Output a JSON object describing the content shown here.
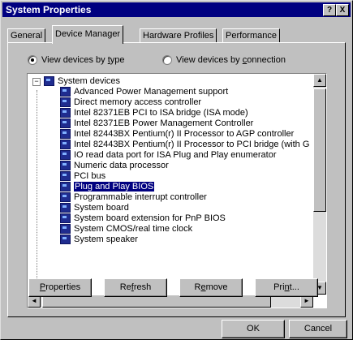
{
  "window": {
    "title": "System Properties"
  },
  "titlebar": {
    "help": "?",
    "close": "X"
  },
  "tabs": [
    {
      "label": "General"
    },
    {
      "label": "Device Manager"
    },
    {
      "label": "Hardware Profiles"
    },
    {
      "label": "Performance"
    }
  ],
  "view": {
    "by_type_pre": "View devices by ",
    "by_type_ul": "t",
    "by_type_post": "ype",
    "by_conn_pre": "View devices by ",
    "by_conn_ul": "c",
    "by_conn_post": "onnection",
    "selected": "by_type"
  },
  "tree": {
    "expander": "−",
    "parent": "System devices",
    "children": [
      "Advanced Power Management support",
      "Direct memory access controller",
      "Intel 82371EB PCI to ISA bridge (ISA mode)",
      "Intel 82371EB Power Management Controller",
      "Intel 82443BX Pentium(r) II Processor to AGP controller",
      "Intel 82443BX Pentium(r) II Processor to PCI bridge (with G",
      "IO read data port for ISA Plug and Play enumerator",
      "Numeric data processor",
      "PCI bus",
      "Plug and Play BIOS",
      "Programmable interrupt controller",
      "System board",
      "System board extension for PnP BIOS",
      "System CMOS/real time clock",
      "System speaker"
    ],
    "selected_index": 9
  },
  "buttons": {
    "properties_ul": "P",
    "properties_rest": "roperties",
    "refresh_pre": "Re",
    "refresh_ul": "f",
    "refresh_rest": "resh",
    "remove_pre": "R",
    "remove_ul": "e",
    "remove_rest": "move",
    "print_pre": "Pri",
    "print_ul": "n",
    "print_rest": "t...",
    "ok": "OK",
    "cancel": "Cancel"
  },
  "icons": {
    "scroll_up": "▲",
    "scroll_down": "▼",
    "scroll_left": "◄",
    "scroll_right": "►"
  }
}
